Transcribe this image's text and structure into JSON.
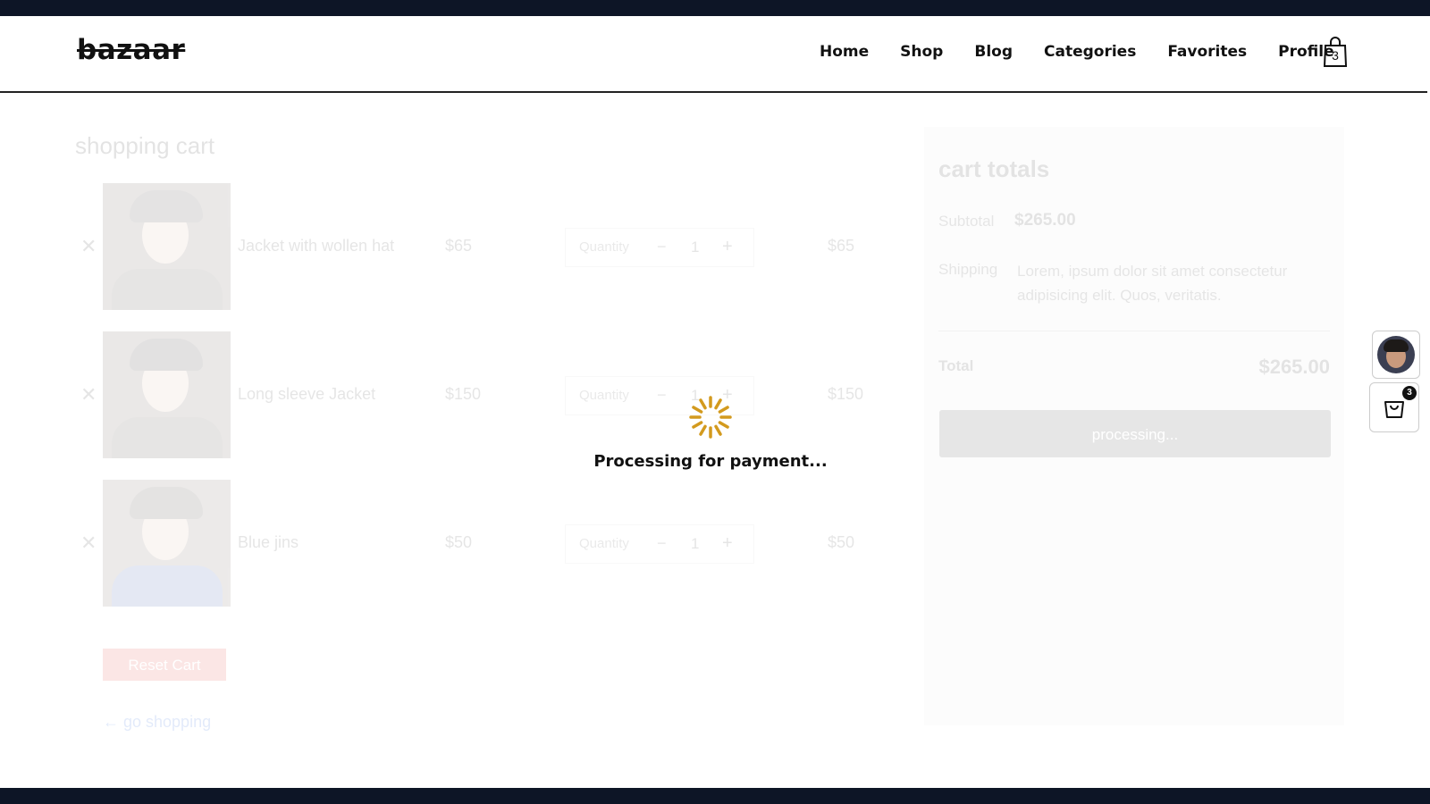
{
  "header": {
    "logo": "bazaar",
    "nav": [
      "Home",
      "Shop",
      "Blog",
      "Categories",
      "Favorites",
      "Profile"
    ],
    "cart_count": "3"
  },
  "cart": {
    "title": "shopping cart",
    "remove_glyph": "✕",
    "quantity_label": "Quantity",
    "minus": "−",
    "plus": "+",
    "items": [
      {
        "name": "Jacket with wollen hat",
        "price": "$65",
        "quantity": "1",
        "subtotal": "$65"
      },
      {
        "name": "Long sleeve Jacket",
        "price": "$150",
        "quantity": "1",
        "subtotal": "$150"
      },
      {
        "name": "Blue jins",
        "price": "$50",
        "quantity": "1",
        "subtotal": "$50"
      }
    ],
    "reset_label": "Reset Cart",
    "go_shopping": "← go shopping"
  },
  "totals": {
    "title": "cart totals",
    "subtotal_label": "Subtotal",
    "subtotal_value": "$265.00",
    "shipping_label": "Shipping",
    "shipping_value": "Lorem, ipsum dolor sit amet consectetur adipisicing elit. Quos, veritatis.",
    "total_label": "Total",
    "total_value": "$265.00",
    "button_label": "processing..."
  },
  "loader": {
    "text": "Processing for payment...",
    "color": "#d39a1e"
  },
  "floating": {
    "cart_badge": "3"
  },
  "icons": {
    "nav_cart": "shopping-bag-icon",
    "remove": "close-icon",
    "loader": "spinner-icon",
    "float_cart": "shopping-bag-icon",
    "float_avatar": "user-avatar"
  }
}
